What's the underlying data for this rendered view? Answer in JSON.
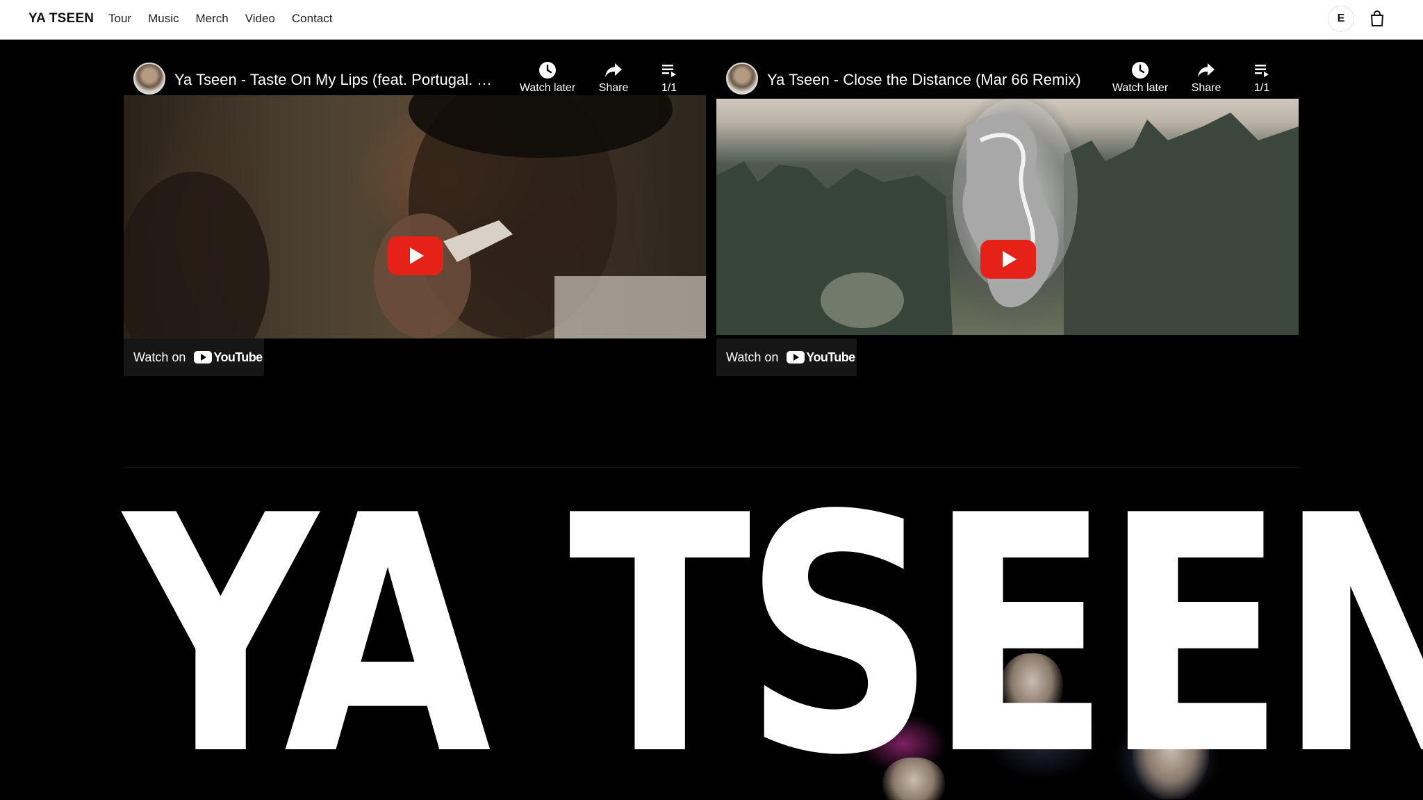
{
  "header": {
    "brand": "YA TSEEN",
    "nav": [
      "Tour",
      "Music",
      "Merch",
      "Video",
      "Contact"
    ],
    "language_button": "E",
    "cart_icon": "shopping-bag-icon"
  },
  "videos": [
    {
      "title": "Ya Tseen - Taste On My Lips (feat. Portugal. The ...",
      "watch_later": "Watch later",
      "share": "Share",
      "playlist_count": "1/1",
      "watch_on": "Watch on",
      "youtube_label": "YouTube"
    },
    {
      "title": "Ya Tseen - Close the Distance (Mar 66 Remix)",
      "watch_later": "Watch later",
      "share": "Share",
      "playlist_count": "1/1",
      "watch_on": "Watch on",
      "youtube_label": "YouTube"
    }
  ],
  "hero": {
    "name": "YA TSEEN"
  },
  "colors": {
    "header_bg": "#ffffff",
    "page_bg": "#000000",
    "play_red": "#e62117",
    "hero_text": "#ffffff"
  }
}
